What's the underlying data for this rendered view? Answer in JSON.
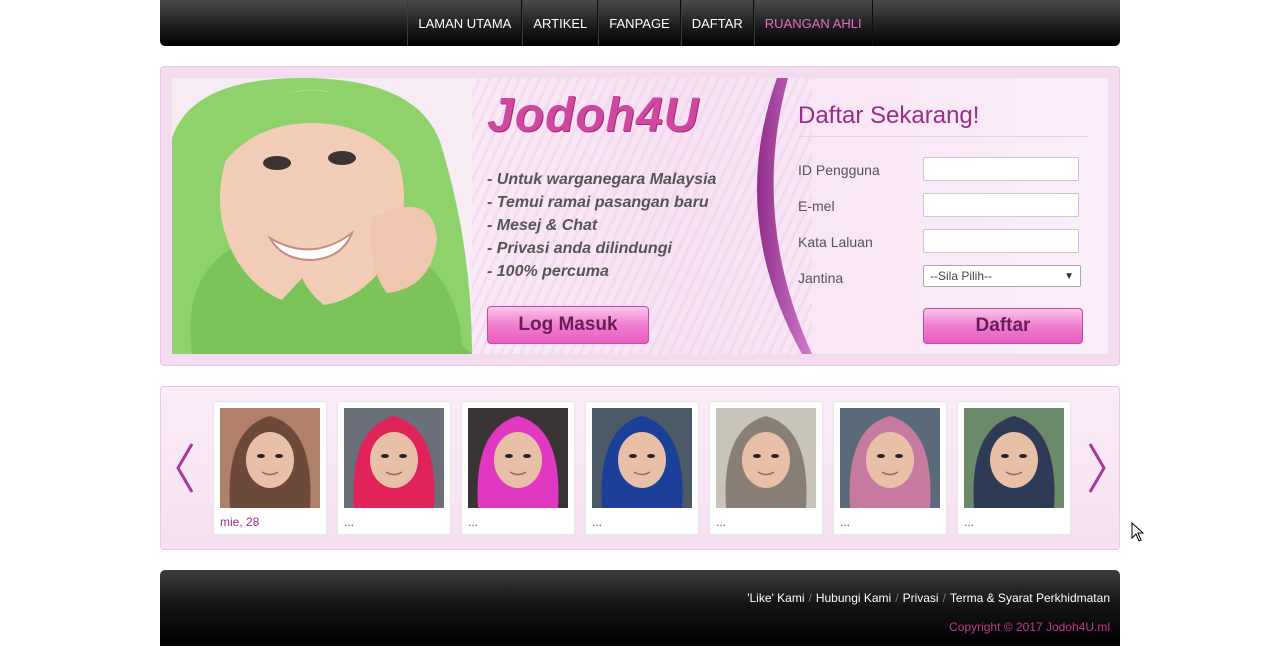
{
  "nav": {
    "items": [
      {
        "label": "LAMAN UTAMA"
      },
      {
        "label": "ARTIKEL"
      },
      {
        "label": "FANPAGE"
      },
      {
        "label": "DAFTAR"
      },
      {
        "label": "RUANGAN AHLI"
      }
    ],
    "active_color": "#e86bc9"
  },
  "hero": {
    "logo": "Jodoh4U",
    "features": [
      "- Untuk warganegara Malaysia",
      "- Temui ramai pasangan baru",
      "- Mesej & Chat",
      "- Privasi anda dilindungi",
      "- 100% percuma"
    ],
    "login_button": "Log Masuk"
  },
  "signup": {
    "title": "Daftar Sekarang!",
    "username_label": "ID Pengguna",
    "email_label": "E-mel",
    "password_label": "Kata Laluan",
    "gender_label": "Jantina",
    "gender_selected": "--Sila Pilih--",
    "submit_label": "Daftar"
  },
  "carousel": {
    "profiles": [
      {
        "caption": "mie, 28",
        "scarf": "#6b4a3a",
        "bg": "#b08068"
      },
      {
        "caption": "...",
        "scarf": "#e0245a",
        "bg": "#6a6f7a"
      },
      {
        "caption": "...",
        "scarf": "#e038c0",
        "bg": "#3a3436"
      },
      {
        "caption": "...",
        "scarf": "#1c3f9a",
        "bg": "#4a5a66"
      },
      {
        "caption": "...",
        "scarf": "#8a7f74",
        "bg": "#c9c4ba"
      },
      {
        "caption": "...",
        "scarf": "#c77aa0",
        "bg": "#5a6a7a"
      },
      {
        "caption": "...",
        "scarf": "#2f3a56",
        "bg": "#6a8a6a"
      }
    ]
  },
  "footer": {
    "links": [
      "'Like' Kami",
      "Hubungi Kami",
      "Privasi",
      "Terma & Syarat Perkhidmatan"
    ],
    "copyright": "Copyright © 2017 Jodoh4U.ml"
  },
  "colors": {
    "brand": "#d0479f",
    "brand_dark": "#9a2b86",
    "button_pink": "#f07ed0"
  }
}
